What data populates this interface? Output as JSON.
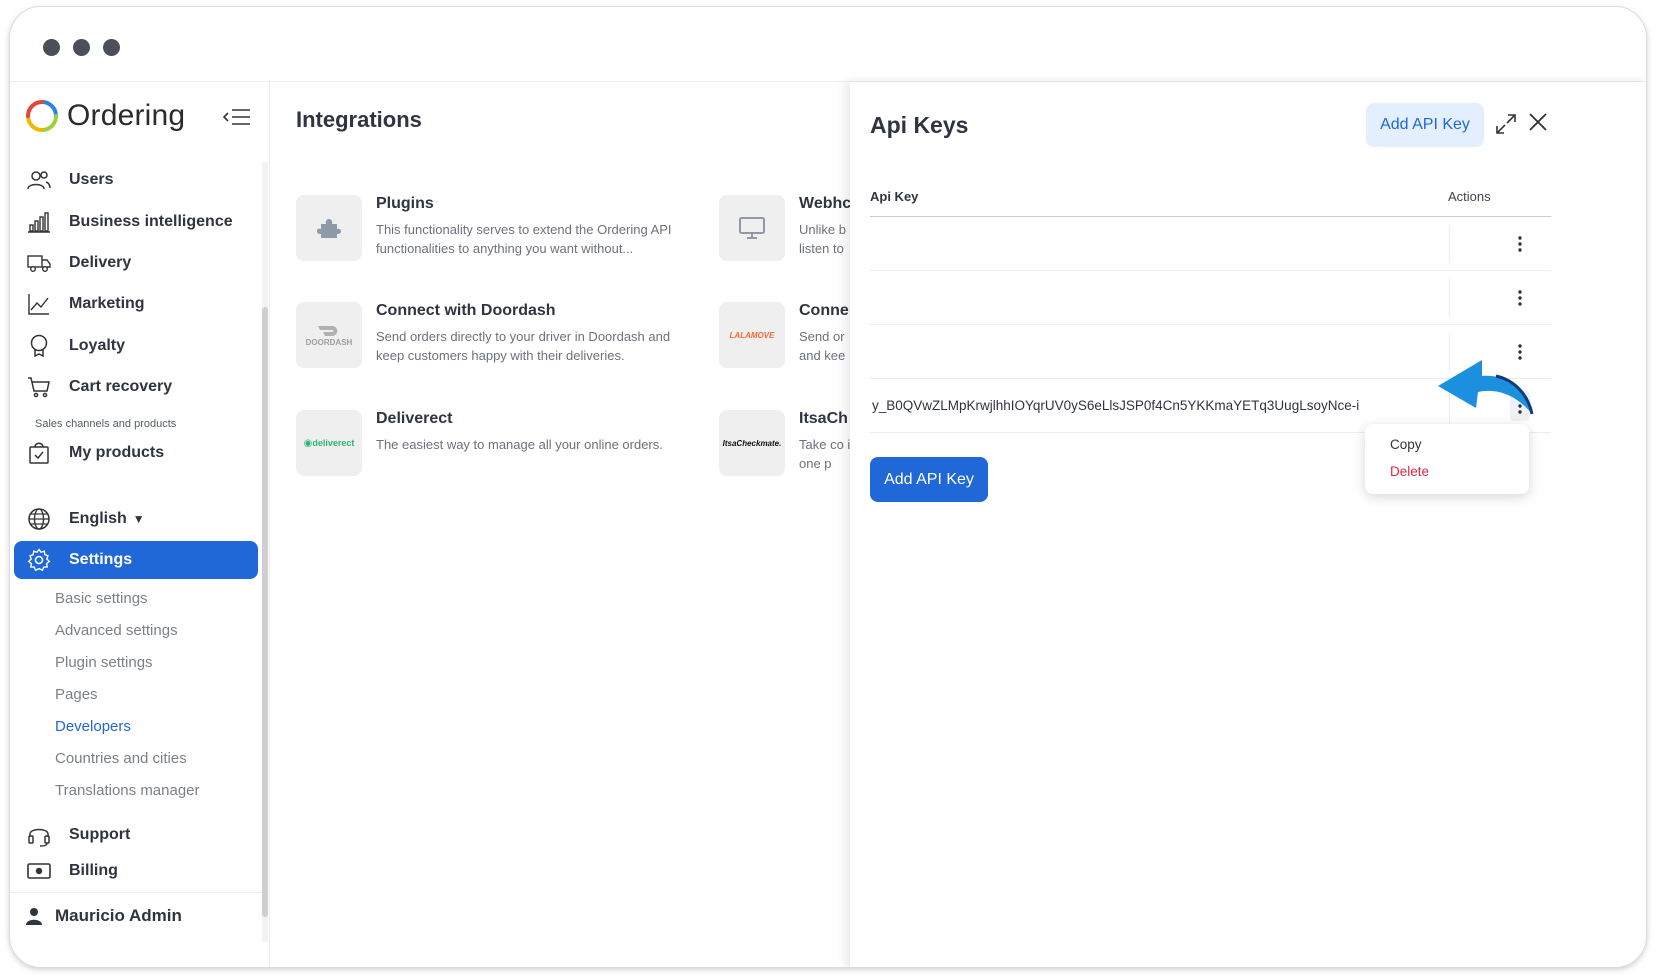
{
  "colors": {
    "accent": "#2067d8",
    "accent_light": "#e3effd",
    "danger": "#e0264a",
    "arrow": "#1d8fdf"
  },
  "sidebar": {
    "brand": "Ordering",
    "nav": [
      {
        "label": "Users",
        "icon": "users-icon"
      },
      {
        "label": "Business intelligence",
        "icon": "bar-chart-icon"
      },
      {
        "label": "Delivery",
        "icon": "truck-icon"
      },
      {
        "label": "Marketing",
        "icon": "trend-line-icon"
      },
      {
        "label": "Loyalty",
        "icon": "award-icon"
      },
      {
        "label": "Cart recovery",
        "icon": "cart-icon"
      }
    ],
    "section_label": "Sales channels and products",
    "products_label": "My products",
    "language": "English",
    "settings_label": "Settings",
    "settings_sub": [
      "Basic settings",
      "Advanced settings",
      "Plugin settings",
      "Pages",
      "Developers",
      "Countries and cities",
      "Translations manager"
    ],
    "support_label": "Support",
    "billing_label": "Billing",
    "user": "Mauricio Admin"
  },
  "main": {
    "title": "Integrations",
    "cards": [
      {
        "title": "Plugins",
        "desc": "This functionality serves to extend the Ordering API functionalities to anything you want without...",
        "logo": "puzzle-icon"
      },
      {
        "title": "Connect with Doordash",
        "desc": "Send orders directly to your driver in Doordash and keep customers happy with their deliveries.",
        "logo": "doordash-logo",
        "logo_text": "DOORDASH"
      },
      {
        "title": "Deliverect",
        "desc": "The easiest way to manage all your online orders.",
        "logo": "deliverect-logo",
        "logo_text": "deliverect"
      },
      {
        "title": "Webhc",
        "desc": "Unlike b listen to",
        "logo": "monitor-icon"
      },
      {
        "title": "Conne",
        "desc": "Send or and kee",
        "logo": "lalamove-logo",
        "logo_text": "LALAMOVE"
      },
      {
        "title": "ItsaCh",
        "desc": "Take co in one p",
        "logo": "itsacheckmate-logo",
        "logo_text": "ItsaCheckmate."
      }
    ]
  },
  "drawer": {
    "title": "Api Keys",
    "add_label_top": "Add API Key",
    "columns": {
      "key": "Api Key",
      "actions": "Actions"
    },
    "rows": [
      {
        "key": ""
      },
      {
        "key": ""
      },
      {
        "key": ""
      },
      {
        "key": "y_B0QVwZLMpKrwjlhhIOYqrUV0yS6eLlsJSP0f4Cn5YKKmaYETq3UugLsoyNce-i"
      }
    ],
    "add_label_bottom": "Add API Key",
    "menu": {
      "copy": "Copy",
      "delete": "Delete"
    }
  }
}
